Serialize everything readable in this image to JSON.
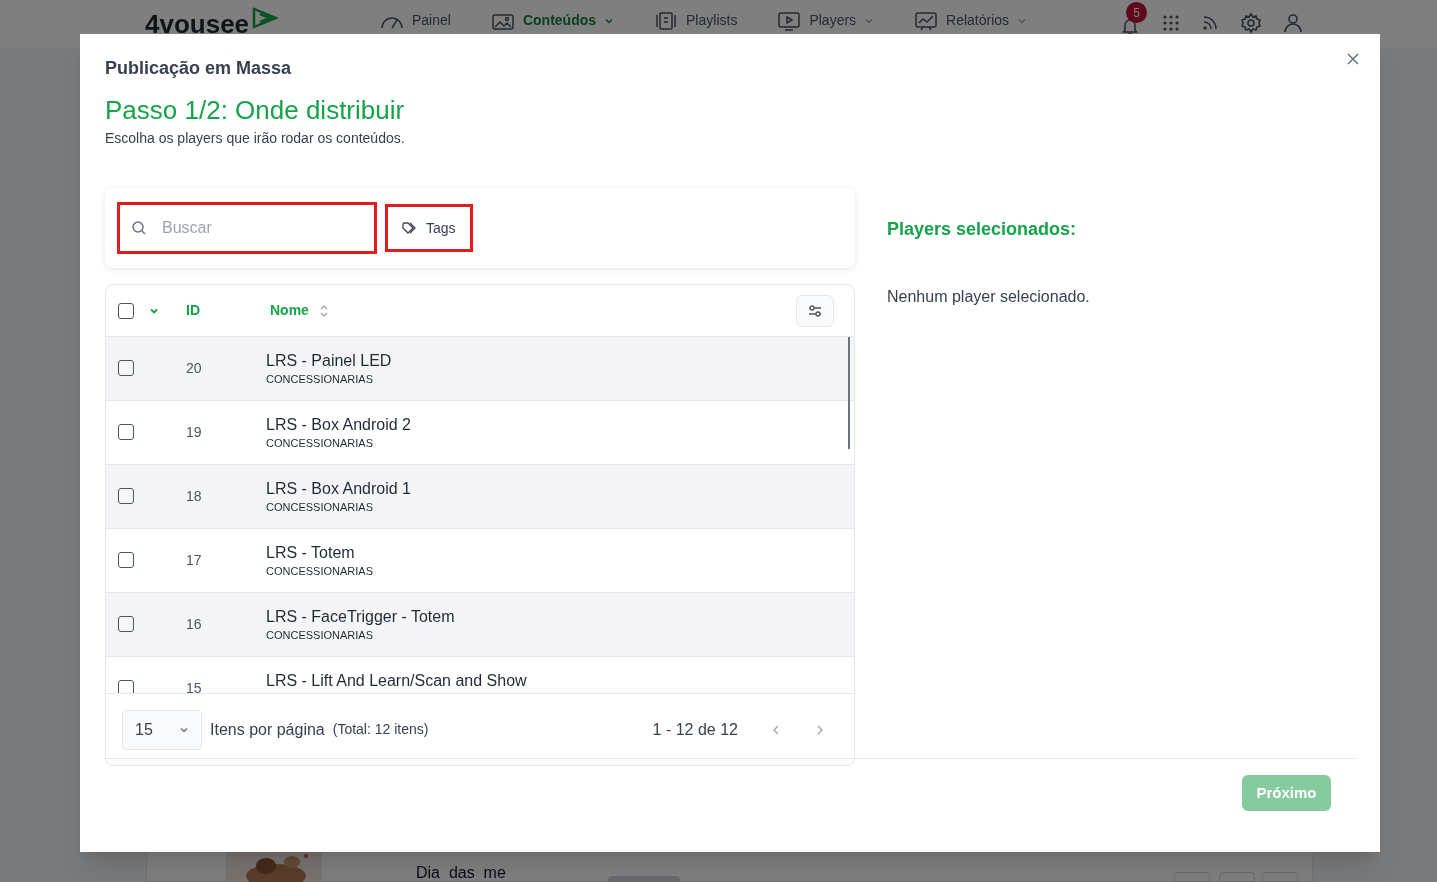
{
  "app": {
    "logo": "4vousee",
    "nav": [
      {
        "label": "Painel",
        "selected": false,
        "dropdown": false
      },
      {
        "label": "Conteúdos",
        "selected": true,
        "dropdown": true
      },
      {
        "label": "Playlists",
        "selected": false,
        "dropdown": false
      },
      {
        "label": "Players",
        "selected": false,
        "dropdown": true
      },
      {
        "label": "Relatórios",
        "selected": false,
        "dropdown": true
      }
    ],
    "notifications": "5",
    "background_item": {
      "title": "Dia  das  me"
    }
  },
  "modal": {
    "heading": "Publicação em Massa",
    "step_title": "Passo 1/2: Onde distribuir",
    "description": "Escolha os players que irão rodar os conteúdos.",
    "search": {
      "placeholder": "Buscar"
    },
    "tags_button": "Tags",
    "table": {
      "all_checked": false,
      "columns": [
        "ID",
        "Nome"
      ],
      "rows": [
        {
          "id": "20",
          "name": "LRS - Painel LED",
          "group": "CONCESSIONARIAS",
          "checked": false
        },
        {
          "id": "19",
          "name": "LRS - Box Android 2",
          "group": "CONCESSIONARIAS",
          "checked": false
        },
        {
          "id": "18",
          "name": "LRS - Box Android 1",
          "group": "CONCESSIONARIAS",
          "checked": false
        },
        {
          "id": "17",
          "name": "LRS - Totem",
          "group": "CONCESSIONARIAS",
          "checked": false
        },
        {
          "id": "16",
          "name": "LRS - FaceTrigger - Totem",
          "group": "CONCESSIONARIAS",
          "checked": false
        },
        {
          "id": "15",
          "name": "LRS - Lift And Learn/Scan and Show",
          "checked": false
        }
      ]
    },
    "pagination": {
      "per_page": "15",
      "per_page_label": "Itens por página",
      "total": "(Total: 12 itens)",
      "range": "1 - 12 de 12"
    },
    "selected_title": "Players selecionados:",
    "selected_empty": "Nenhum player selecionado.",
    "next_button": "Próximo",
    "next_disabled": true
  }
}
